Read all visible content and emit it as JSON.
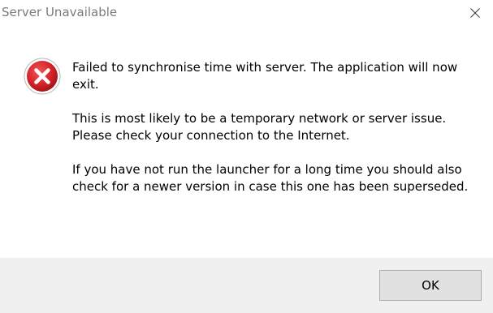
{
  "window": {
    "title": "Server Unavailable",
    "close_icon": "close-icon"
  },
  "message": {
    "icon": "error-icon",
    "paragraphs": [
      "Failed to synchronise time with server. The application will now exit.",
      "This is most likely to be a temporary network or server issue. Please check your connection to the Internet.",
      "If you have not run the launcher for a long time you should also check for a newer version in case this one has been superseded."
    ]
  },
  "buttons": {
    "ok_label": "OK"
  },
  "colors": {
    "error_red": "#d8262b",
    "footer_bg": "#f0f0f0",
    "button_bg": "#e1e1e1",
    "title_text": "#7a7a7a"
  }
}
